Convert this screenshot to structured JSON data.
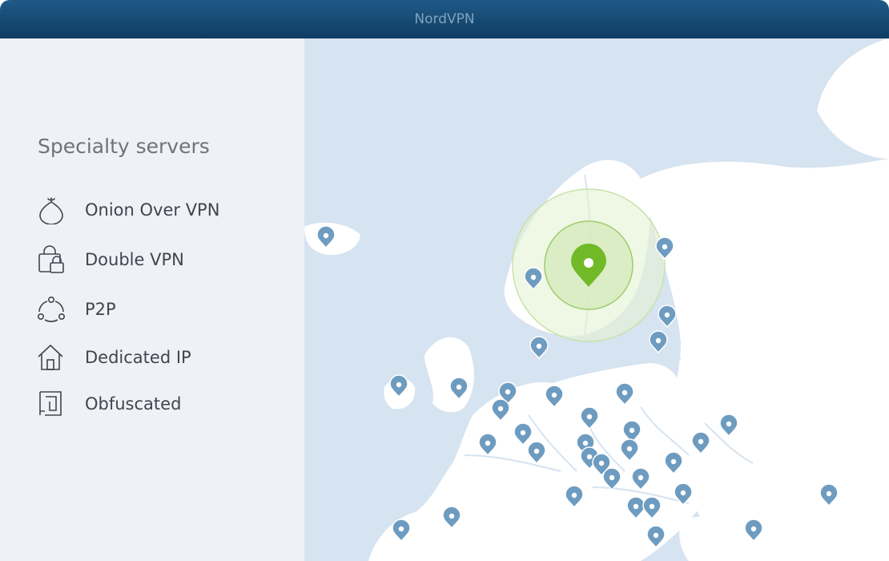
{
  "app": {
    "title": "NordVPN"
  },
  "sidebar": {
    "heading": "Specialty servers",
    "items": [
      {
        "label": "Onion Over VPN",
        "icon": "onion-icon"
      },
      {
        "label": "Double VPN",
        "icon": "double-lock-icon"
      },
      {
        "label": "P2P",
        "icon": "p2p-icon"
      },
      {
        "label": "Dedicated IP",
        "icon": "home-icon"
      },
      {
        "label": "Obfuscated",
        "icon": "obfuscated-icon"
      }
    ]
  },
  "map": {
    "active_server_icon": "location-pin-icon",
    "colors": {
      "water": "#d6e3f0",
      "land": "#ffffff",
      "pin": "#6e9cc0",
      "active_pin": "#72b928",
      "active_ring": "#e5f1d4"
    }
  }
}
